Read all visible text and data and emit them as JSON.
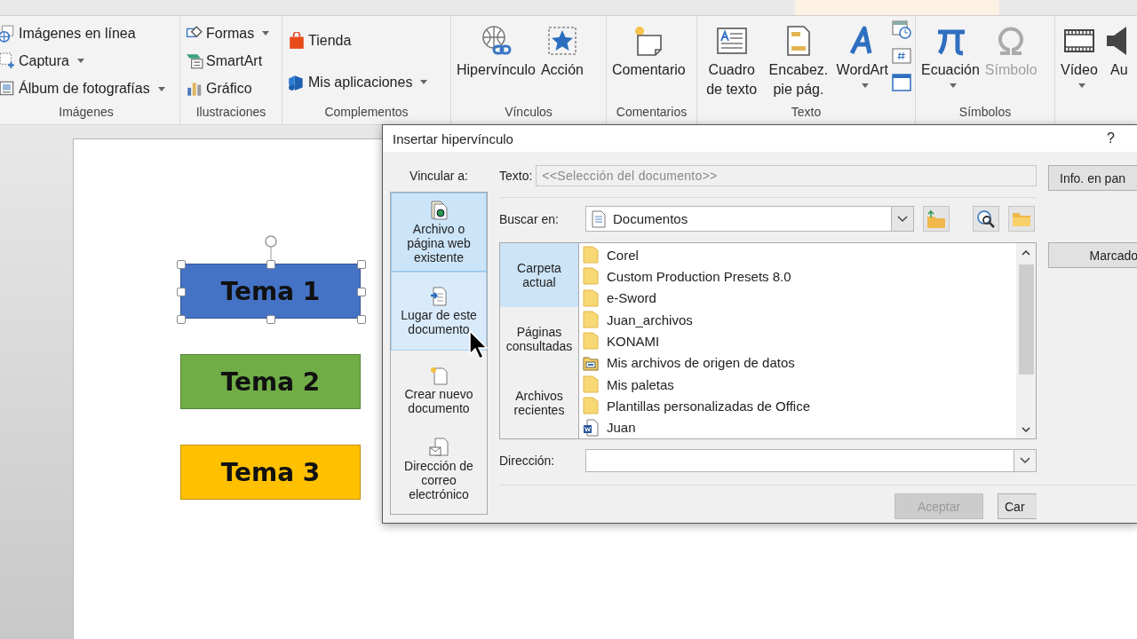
{
  "ribbon": {
    "groups": [
      {
        "label": "Imágenes",
        "items": [
          {
            "kind": "small",
            "label": "Imágenes en línea",
            "dropdown": false
          },
          {
            "kind": "small",
            "label": "Captura",
            "dropdown": true
          },
          {
            "kind": "small",
            "label": "Álbum de fotografías",
            "dropdown": true
          }
        ]
      },
      {
        "label": "Ilustraciones",
        "items": [
          {
            "kind": "small",
            "label": "Formas",
            "dropdown": true
          },
          {
            "kind": "small",
            "label": "SmartArt",
            "dropdown": false
          },
          {
            "kind": "small",
            "label": "Gráfico",
            "dropdown": false
          }
        ]
      },
      {
        "label": "Complementos",
        "items": [
          {
            "kind": "small",
            "label": "Tienda",
            "dropdown": false
          },
          {
            "kind": "small",
            "label": "Mis aplicaciones",
            "dropdown": true
          }
        ]
      },
      {
        "label": "Vínculos",
        "items": [
          {
            "kind": "large",
            "label": "Hipervínculo",
            "dropdown": false
          },
          {
            "kind": "large",
            "label": "Acción",
            "dropdown": false
          }
        ]
      },
      {
        "label": "Comentarios",
        "items": [
          {
            "kind": "large",
            "label": "Comentario",
            "dropdown": false
          }
        ]
      },
      {
        "label": "Texto",
        "items": [
          {
            "kind": "large",
            "label": "Cuadro de texto",
            "dropdown": false
          },
          {
            "kind": "large",
            "label": "Encabez. pie pág.",
            "dropdown": false
          },
          {
            "kind": "large",
            "label": "WordArt",
            "dropdown": true
          },
          {
            "kind": "mini-stack"
          }
        ]
      },
      {
        "label": "Símbolos",
        "items": [
          {
            "kind": "large",
            "label": "Ecuación",
            "dropdown": true,
            "disabled": false
          },
          {
            "kind": "large",
            "label": "Símbolo",
            "dropdown": false,
            "disabled": true
          }
        ]
      },
      {
        "items": [
          {
            "kind": "large",
            "label": "Vídeo",
            "dropdown": true
          },
          {
            "kind": "large",
            "label": "Au",
            "dropdown": false
          }
        ]
      }
    ]
  },
  "slide": {
    "shapes": [
      {
        "text": "Tema 1",
        "color": "#4472c4",
        "selected": true
      },
      {
        "text": "Tema 2",
        "color": "#70ad47",
        "selected": false
      },
      {
        "text": "Tema 3",
        "color": "#ffc000",
        "selected": false
      }
    ]
  },
  "dialog": {
    "title": "Insertar hipervínculo",
    "help": "?",
    "link_to_label": "Vincular a:",
    "link_to": [
      {
        "label": "Archivo o página web existente",
        "selected": true,
        "hovered": false
      },
      {
        "label": "Lugar de este documento",
        "selected": false,
        "hovered": true
      },
      {
        "label": "Crear nuevo documento",
        "selected": false,
        "hovered": false
      },
      {
        "label": "Dirección de correo electrónico",
        "selected": false,
        "hovered": false
      }
    ],
    "text_label": "Texto:",
    "text_field": {
      "value": "<<Selección del documento>>",
      "disabled": true
    },
    "look_in_label": "Buscar en:",
    "look_in": "Documentos",
    "nav": [
      {
        "label": "Carpeta actual",
        "selected": true
      },
      {
        "label": "Páginas consultadas",
        "selected": false
      },
      {
        "label": "Archivos recientes",
        "selected": false
      }
    ],
    "files": [
      {
        "name": "Corel",
        "kind": "folder"
      },
      {
        "name": "Custom Production Presets 8.0",
        "kind": "folder"
      },
      {
        "name": "e-Sword",
        "kind": "folder"
      },
      {
        "name": "Juan_archivos",
        "kind": "folder"
      },
      {
        "name": "KONAMI",
        "kind": "folder"
      },
      {
        "name": "Mis archivos de origen de datos",
        "kind": "data-folder"
      },
      {
        "name": "Mis paletas",
        "kind": "folder"
      },
      {
        "name": "Plantillas personalizadas de Office",
        "kind": "folder"
      },
      {
        "name": "Juan",
        "kind": "word-document"
      }
    ],
    "address_label": "Dirección:",
    "side_buttons": [
      "Info. en pan",
      "Marcado"
    ],
    "ok_button": {
      "label": "Aceptar",
      "disabled": true
    },
    "cancel_button": {
      "label": "Car"
    }
  }
}
